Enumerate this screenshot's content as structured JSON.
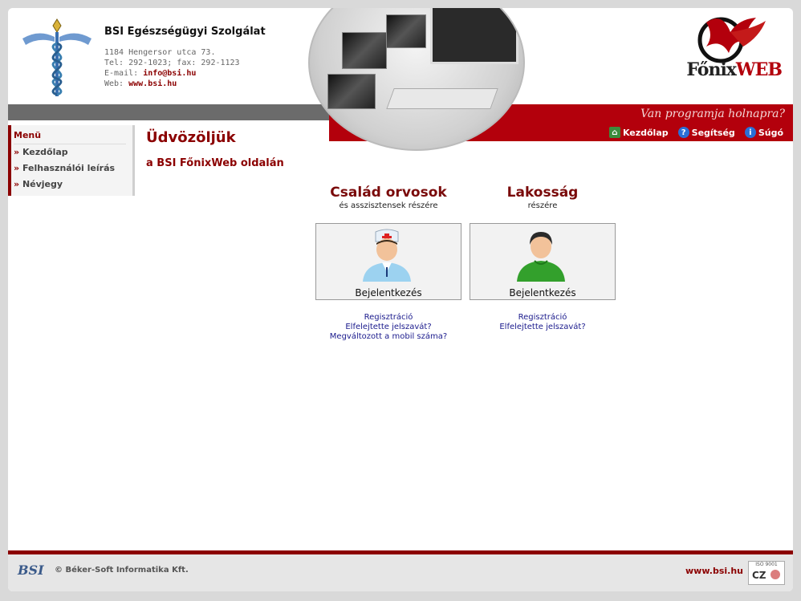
{
  "header": {
    "org_name": "BSI Egészségügyi Szolgálat",
    "address": "1184 Hengersor utca 73.",
    "phone_line": "Tel: 292-1023; fax: 292-1123",
    "email_label": "E-mail:",
    "email": "info@bsi.hu",
    "web_label": "Web:",
    "web": "www.bsi.hu",
    "slogan": "Van programja holnapra?",
    "brand_part1": "Főnix",
    "brand_part2": "WEB"
  },
  "toplinks": [
    {
      "label": "Kezdőlap",
      "icon": "home-icon",
      "color": "#3c8c3c"
    },
    {
      "label": "Segítség",
      "icon": "help-icon",
      "color": "#2a6fd6"
    },
    {
      "label": "Súgó",
      "icon": "info-icon",
      "color": "#2a6fd6"
    }
  ],
  "sidebar": {
    "title": "Menü",
    "items": [
      {
        "label": "Kezdőlap"
      },
      {
        "label": "Felhasználói leírás"
      },
      {
        "label": "Névjegy"
      }
    ]
  },
  "main": {
    "welcome": "Üdvözöljük",
    "subwelcome": "a BSI FőnixWeb oldalán",
    "doctors": {
      "title": "Család orvosok",
      "subtitle": "és asszisztensek részére",
      "login": "Bejelentkezés",
      "links": [
        "Regisztráció",
        "Elfelejtette jelszavát?",
        "Megváltozott a mobil száma?"
      ]
    },
    "public": {
      "title": "Lakosság",
      "subtitle": "részére",
      "login": "Bejelentkezés",
      "links": [
        "Regisztráció",
        "Elfelejtette jelszavát?"
      ]
    }
  },
  "footer": {
    "logo": "BSI",
    "copyright": "© Béker-Soft Informatika Kft.",
    "web": "www.bsi.hu",
    "iso": "ISO 9001"
  },
  "colors": {
    "accent_red": "#b3000c",
    "dark_red": "#8b0000",
    "link_blue": "#1a1a8c"
  }
}
